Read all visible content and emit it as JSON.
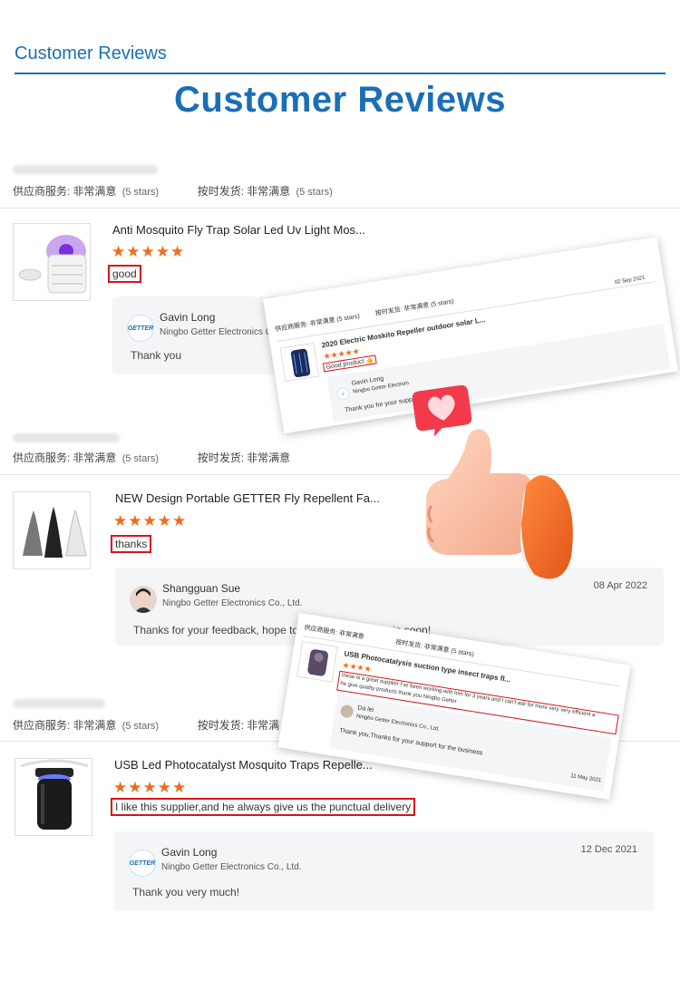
{
  "header": {
    "small_title": "Customer Reviews",
    "big_title": "Customer Reviews"
  },
  "reviews": [
    {
      "ratings": {
        "service_label": "供应商服务:",
        "service_value": "非常满意",
        "service_stars": "(5 stars)",
        "delivery_label": "按时发货:",
        "delivery_value": "非常满意",
        "delivery_stars": "(5 stars)"
      },
      "product_title": "Anti Mosquito Fly Trap Solar Led Uv Light Mos...",
      "stars": "★★★★★",
      "comment": "good",
      "reply": {
        "name": "Gavin Long",
        "company": "Ningbo Getter Electronics Co., Ltd.",
        "date": "",
        "message": "Thank you"
      }
    },
    {
      "ratings": {
        "service_label": "供应商服务:",
        "service_value": "非常满意",
        "service_stars": "(5 stars)",
        "delivery_label": "按时发货:",
        "delivery_value": "非常满意",
        "delivery_stars": ""
      },
      "product_title": "NEW Design Portable GETTER Fly Repellent Fa...",
      "stars": "★★★★★",
      "comment": "thanks",
      "reply": {
        "name": "Shangguan Sue",
        "company": "Ningbo Getter Electronics Co., Ltd.",
        "date": "08 Apr 2022",
        "message": "Thanks for your feedback, hope to",
        "message_tail": "again soon!"
      }
    },
    {
      "ratings": {
        "service_label": "供应商服务:",
        "service_value": "非常满意",
        "service_stars": "(5 stars)",
        "delivery_label": "按时发货:",
        "delivery_value": "非常满",
        "delivery_stars": ""
      },
      "product_title": "USB Led Photocatalyst Mosquito Traps Repelle...",
      "stars": "★★★★★",
      "comment": "I like this supplier,and he always give us the punctual delivery",
      "reply": {
        "name": "Gavin Long",
        "company": "Ningbo Getter Electronics Co., Ltd.",
        "date": "12 Dec 2021",
        "message": "Thank you very much!"
      }
    }
  ],
  "overlay_card_1": {
    "service": "供应商服务: 非常满意 (5 stars)",
    "delivery": "按时发货: 非常满意 (5 stars)",
    "product_title": "2020 Electric Moskito Repeller outdoor solar L...",
    "date": "02 Sep 2021",
    "stars": "★★★★★",
    "comment": "Good product 👍",
    "reply_name": "Gavin Long",
    "reply_company": "Ningbo Getter Electroni",
    "reply_message": "Thank you for your suppor"
  },
  "overlay_card_2": {
    "service": "供应商服务: 非常满意",
    "delivery": "按时发货: 非常满意 (5 stars)",
    "product_title": "USB Photocatalysis suction type insect traps fl...",
    "stars": "★★★★",
    "comment_line1": "Inese is a great supplier I've been working with him for 3 years and I can't ask for more very very efficient a",
    "comment_line2": "he give quality products thank you Ningbo Getter",
    "reply_name": "Da lei",
    "reply_company": "Ningbo Getter Electronics Co., Ltd.",
    "reply_message": "Thank you,Thanks for your support for the business",
    "date": "11 May 2021"
  },
  "colors": {
    "brand_blue": "#1a6fb5",
    "star_orange": "#f26a1b",
    "highlight_red": "#d9121a",
    "reply_bg": "#f4f5f7"
  },
  "icons": [
    "heart-icon",
    "thumbs-up-icon",
    "getter-logo-icon"
  ]
}
